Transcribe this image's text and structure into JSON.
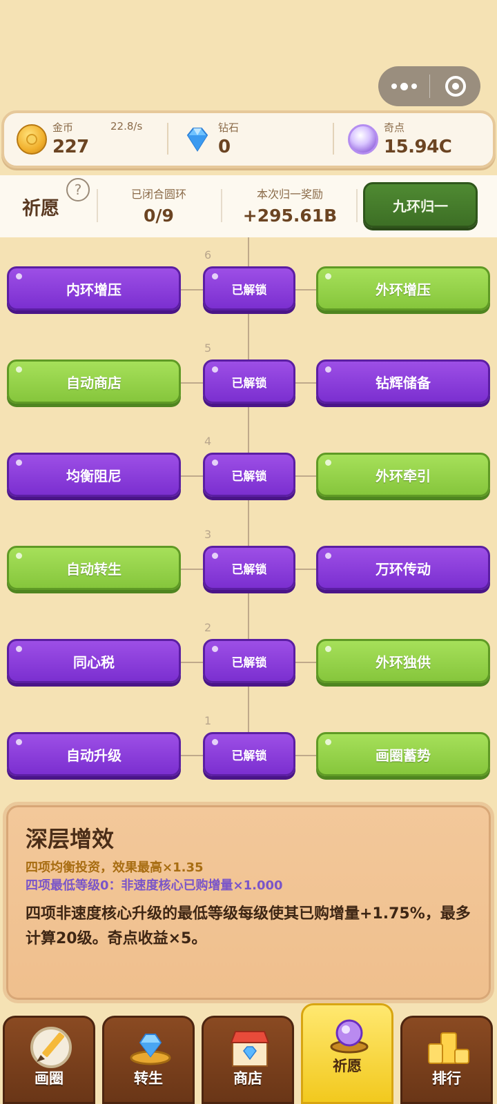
{
  "capsule": {
    "more_icon": "more-dots-icon",
    "close_icon": "target-circle-icon"
  },
  "currency": {
    "gold": {
      "label": "金币",
      "value": "227",
      "rate": "22.8/s",
      "icon": "gold-coin-icon"
    },
    "diamond": {
      "label": "钻石",
      "value": "0",
      "icon": "diamond-icon"
    },
    "qidian": {
      "label": "奇点",
      "value": "15.94C",
      "icon": "purple-orb-icon"
    }
  },
  "wish": {
    "title": "祈愿",
    "closed_rings_label": "已闭合圆环",
    "closed_rings_value": "0/9",
    "reward_label": "本次归一奖励",
    "reward_value": "+295.61B",
    "return_button": "九环归一"
  },
  "tree": {
    "rows": [
      {
        "level": "6",
        "left": "内环增压",
        "left_color": "purple",
        "center": "已解锁",
        "right": "外环增压",
        "right_color": "green"
      },
      {
        "level": "5",
        "left": "自动商店",
        "left_color": "green",
        "center": "已解锁",
        "right": "钻辉储备",
        "right_color": "purple"
      },
      {
        "level": "4",
        "left": "均衡阻尼",
        "left_color": "purple",
        "center": "已解锁",
        "right": "外环牵引",
        "right_color": "green"
      },
      {
        "level": "3",
        "left": "自动转生",
        "left_color": "green",
        "center": "已解锁",
        "right": "万环传动",
        "right_color": "purple"
      },
      {
        "level": "2",
        "left": "同心税",
        "left_color": "purple",
        "center": "已解锁",
        "right": "外环独供",
        "right_color": "green"
      },
      {
        "level": "1",
        "left": "自动升级",
        "left_color": "purple",
        "center": "已解锁",
        "right": "画圈蓄势",
        "right_color": "green"
      }
    ]
  },
  "info": {
    "title": "深层增效",
    "line1": "四项均衡投资，效果最高×1.35",
    "line2": "四项最低等级0：非速度核心已购增量×1.000",
    "description": "四项非速度核心升级的最低等级每级使其已购增量+1.75%，最多计算20级。奇点收益×5。"
  },
  "nav": {
    "items": [
      {
        "label": "画圈",
        "icon": "pencil-circle-icon"
      },
      {
        "label": "转生",
        "icon": "diamond-ring-icon"
      },
      {
        "label": "商店",
        "icon": "shop-icon"
      },
      {
        "label": "祈愿",
        "icon": "wish-orb-icon",
        "active": true
      },
      {
        "label": "排行",
        "icon": "podium-icon"
      }
    ]
  },
  "colors": {
    "purple": "#8a3fdc",
    "green": "#96d24a",
    "panel": "#f0c390",
    "background": "#f5e2b4"
  }
}
